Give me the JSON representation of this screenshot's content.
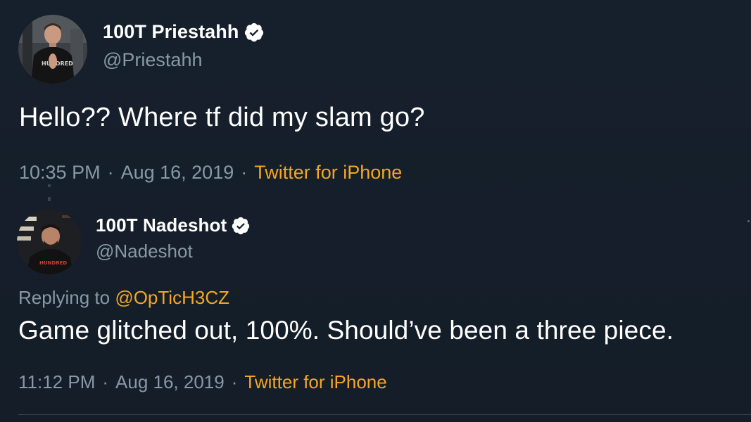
{
  "tweets": [
    {
      "display_name": "100T Priestahh",
      "handle": "@Priestahh",
      "text": "Hello?? Where tf did my slam go?",
      "time": "10:35 PM",
      "separator": "·",
      "date": "Aug 16, 2019",
      "source": "Twitter for iPhone"
    },
    {
      "display_name": "100T Nadeshot",
      "handle": "@Nadeshot",
      "replying_prefix": "Replying to",
      "replying_to": "@OpTicH3CZ",
      "text": "Game glitched out, 100%. Should’ve been a three piece.",
      "time": "11:12 PM",
      "separator": "·",
      "date": "Aug 16, 2019",
      "source": "Twitter for iPhone"
    }
  ],
  "colors": {
    "background": "#15202b",
    "primary_text": "#ffffff",
    "secondary_text": "#8899a6",
    "accent": "#f5a623",
    "verified_badge": "#ffffff",
    "divider": "#38444d"
  },
  "icons": {
    "verified": "verified-badge-icon",
    "avatar_1": "avatar-photo",
    "avatar_2": "avatar-photo"
  }
}
